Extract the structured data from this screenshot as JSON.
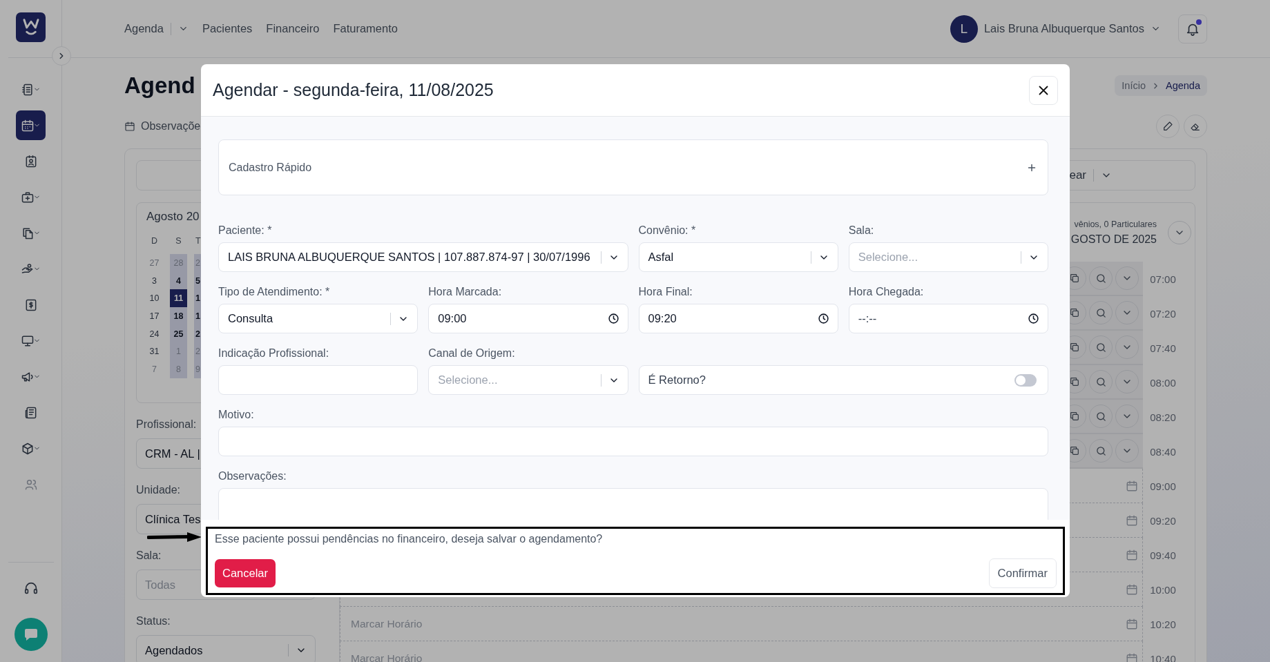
{
  "sidebar": {
    "items": [
      {
        "kind": "list",
        "dropdown": true,
        "selected": false,
        "disabled": false
      },
      {
        "kind": "calendar",
        "dropdown": true,
        "selected": true,
        "disabled": false
      },
      {
        "kind": "contact",
        "dropdown": false,
        "selected": false,
        "disabled": false
      },
      {
        "kind": "medical",
        "dropdown": true,
        "selected": false,
        "disabled": false
      },
      {
        "kind": "documents",
        "dropdown": true,
        "selected": false,
        "disabled": false
      },
      {
        "kind": "hand",
        "dropdown": true,
        "selected": false,
        "disabled": false
      },
      {
        "kind": "receipt",
        "dropdown": false,
        "selected": false,
        "disabled": false
      },
      {
        "kind": "monitor",
        "dropdown": true,
        "selected": false,
        "disabled": false
      },
      {
        "kind": "megaphone",
        "dropdown": true,
        "selected": false,
        "disabled": false
      },
      {
        "kind": "newspaper",
        "dropdown": false,
        "selected": false,
        "disabled": false
      },
      {
        "kind": "box",
        "dropdown": true,
        "selected": false,
        "disabled": false
      },
      {
        "kind": "users",
        "dropdown": false,
        "selected": false,
        "disabled": true
      }
    ]
  },
  "topnav": [
    {
      "label": "Agenda",
      "kind": "dropdown"
    },
    {
      "label": "Pacientes",
      "kind": "link"
    },
    {
      "label": "Financeiro",
      "kind": "link"
    },
    {
      "label": "Faturamento",
      "kind": "link"
    }
  ],
  "user": {
    "initial": "L",
    "name": "Lais Bruna Albuquerque Santos"
  },
  "notifications": {
    "unread": true
  },
  "page": {
    "title": "Agend",
    "note": "Observaçõe",
    "breadcrumb": [
      {
        "label": "Início",
        "selected": false
      },
      {
        "label": "Agenda",
        "selected": true
      }
    ]
  },
  "calendar": {
    "title": "Agosto  20",
    "weekdays": [
      {
        "label": "D",
        "highlighted": false
      },
      {
        "label": "S",
        "highlighted": true
      },
      {
        "label": "T",
        "highlighted": true
      }
    ],
    "weeks": [
      [
        {
          "day": "27",
          "muted": true,
          "selected": false
        },
        {
          "day": "28",
          "muted": true,
          "selected": false
        },
        {
          "day": "2",
          "muted": true,
          "selected": false
        }
      ],
      [
        {
          "day": "3",
          "muted": false,
          "selected": false
        },
        {
          "day": "4",
          "muted": false,
          "selected": false
        },
        {
          "day": "5",
          "muted": false,
          "selected": false
        }
      ],
      [
        {
          "day": "10",
          "muted": false,
          "selected": false
        },
        {
          "day": "11",
          "muted": false,
          "selected": true
        },
        {
          "day": "1",
          "muted": false,
          "selected": false
        }
      ],
      [
        {
          "day": "17",
          "muted": false,
          "selected": false
        },
        {
          "day": "18",
          "muted": false,
          "selected": false
        },
        {
          "day": "1",
          "muted": false,
          "selected": false
        }
      ],
      [
        {
          "day": "24",
          "muted": false,
          "selected": false
        },
        {
          "day": "25",
          "muted": false,
          "selected": false
        },
        {
          "day": "2",
          "muted": false,
          "selected": false
        }
      ],
      [
        {
          "day": "31",
          "muted": false,
          "selected": false
        },
        {
          "day": "1",
          "muted": true,
          "selected": false
        },
        {
          "day": "2",
          "muted": true,
          "selected": false
        }
      ],
      [
        {
          "day": "7",
          "muted": true,
          "selected": false
        },
        {
          "day": "8",
          "muted": true,
          "selected": false
        },
        {
          "day": "9",
          "muted": true,
          "selected": false
        }
      ]
    ]
  },
  "filters": [
    {
      "label": "Profissional:",
      "value": "CRM - AL |",
      "kind": "text"
    },
    {
      "label": "Unidade:",
      "value": "Clínica Tes",
      "kind": "text"
    },
    {
      "label": "Sala:",
      "placeholder": "Todas",
      "kind": "text"
    },
    {
      "label": "Status:",
      "value": "Agendados",
      "kind": "select"
    }
  ],
  "toolbar": {
    "value": "ear"
  },
  "schedule": {
    "summary": "vênios, 0 Particulares",
    "month": "GOSTO DE 2025",
    "slots": [
      {
        "time": "07:00",
        "kind": "booked"
      },
      {
        "time": "07:20",
        "kind": "booked"
      },
      {
        "time": "07:40",
        "kind": "booked"
      },
      {
        "time": "08:00",
        "kind": "booked"
      },
      {
        "time": "08:20",
        "kind": "booked"
      },
      {
        "time": "08:40",
        "kind": "booked"
      },
      {
        "time": "09:00",
        "kind": "free"
      },
      {
        "time": "09:20",
        "kind": "free"
      },
      {
        "time": "09:40",
        "kind": "free"
      },
      {
        "time": "10:00",
        "kind": "free"
      },
      {
        "time": "10:20",
        "kind": "free",
        "label": "Marcar Horário"
      },
      {
        "time": "10:40",
        "kind": "free",
        "label": "Marcar Horário"
      }
    ]
  },
  "modal": {
    "title": "Agendar - segunda-feira, 11/08/2025",
    "quick_register": "Cadastro Rápido",
    "fields": [
      {
        "label": "Paciente: *",
        "kind": "select",
        "value": "LAIS BRUNA ALBUQUERQUE SANTOS | 107.887.874-97 | 30/07/1996",
        "wide": true
      },
      {
        "label": "Convênio: *",
        "kind": "select",
        "value": "Asfal",
        "wide": false
      },
      {
        "label": "Sala:",
        "kind": "select",
        "placeholder": "Selecione...",
        "wide": false
      },
      {
        "label": "Tipo de Atendimento: *",
        "kind": "select",
        "value": "Consulta",
        "wide": false
      },
      {
        "label": "Hora Marcada:",
        "kind": "time",
        "value": "09:00",
        "wide": false
      },
      {
        "label": "Hora Final:",
        "kind": "time",
        "value": "09:20",
        "wide": false
      },
      {
        "label": "Hora Chegada:",
        "kind": "time",
        "placeholder": "--:--",
        "wide": false
      },
      {
        "label": "Indicação Profissional:",
        "kind": "text",
        "wide": false
      },
      {
        "label": "Canal de Origem:",
        "kind": "select",
        "placeholder": "Selecione...",
        "wide": false
      },
      {
        "kind": "toggle",
        "text": "É Retorno?",
        "on": false,
        "wide": true
      },
      {
        "label": "Motivo:",
        "kind": "long-text"
      },
      {
        "label": "Observações:",
        "kind": "textarea"
      }
    ],
    "confirm": {
      "message": "Esse paciente possui pendências no financeiro, deseja salvar o agendamento?",
      "cancel": "Cancelar",
      "ok": "Confirmar"
    }
  }
}
